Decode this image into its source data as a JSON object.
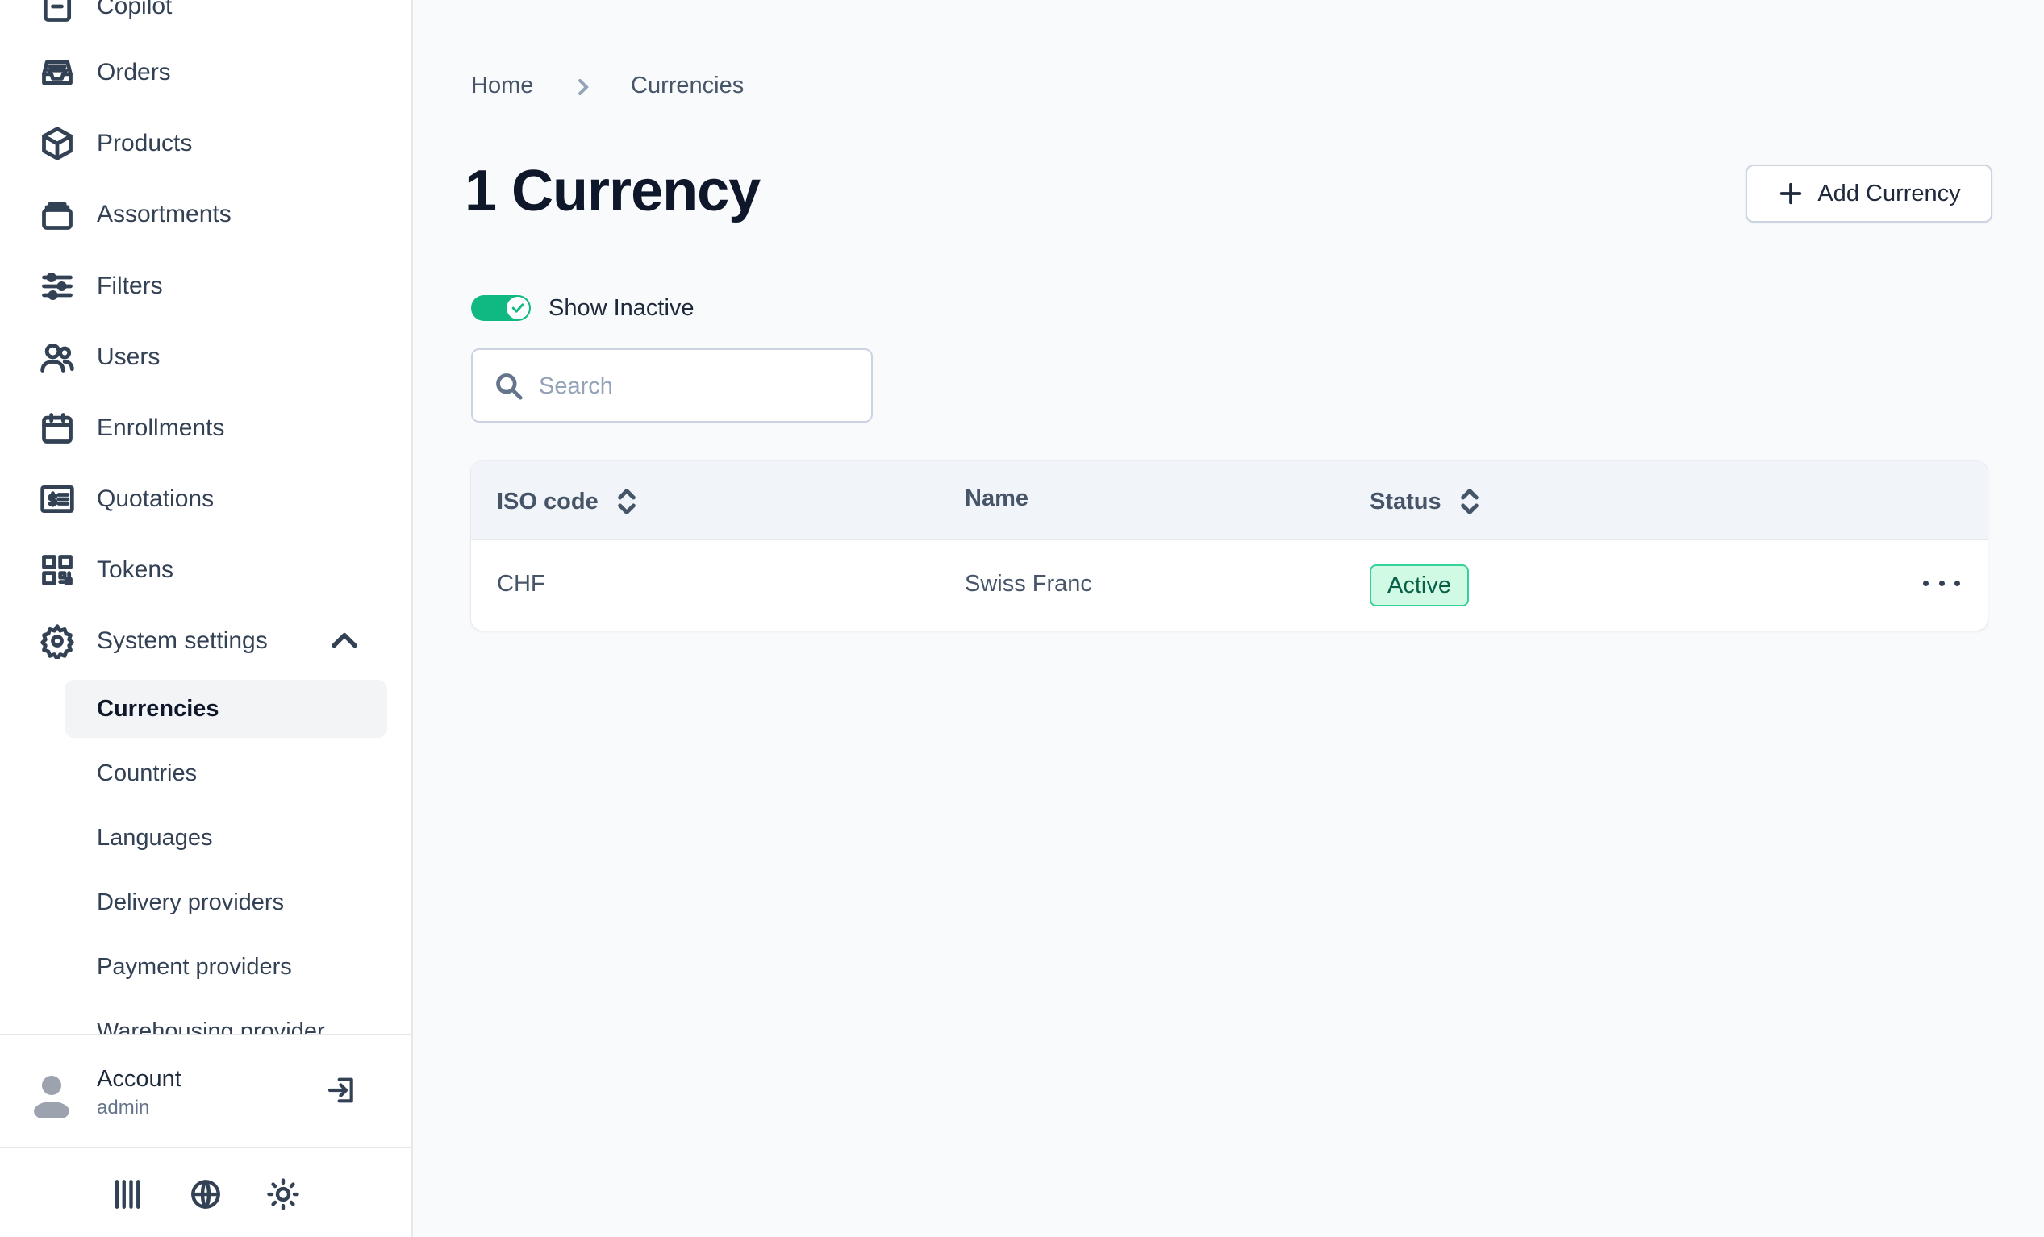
{
  "sidebar": {
    "items": [
      {
        "label": "Copilot",
        "icon": "copilot-icon"
      },
      {
        "label": "Orders",
        "icon": "inbox-icon"
      },
      {
        "label": "Products",
        "icon": "cube-icon"
      },
      {
        "label": "Assortments",
        "icon": "stack-icon"
      },
      {
        "label": "Filters",
        "icon": "sliders-icon"
      },
      {
        "label": "Users",
        "icon": "users-icon"
      },
      {
        "label": "Enrollments",
        "icon": "calendar-icon"
      },
      {
        "label": "Quotations",
        "icon": "receipt-icon"
      },
      {
        "label": "Tokens",
        "icon": "qr-code-icon"
      },
      {
        "label": "System settings",
        "icon": "gear-icon"
      }
    ],
    "sub_items": [
      {
        "label": "Currencies",
        "active": true
      },
      {
        "label": "Countries"
      },
      {
        "label": "Languages"
      },
      {
        "label": "Delivery providers"
      },
      {
        "label": "Payment providers"
      },
      {
        "label": "Warehousing provider"
      }
    ],
    "account": {
      "name": "Account",
      "role": "admin"
    }
  },
  "breadcrumb": {
    "home": "Home",
    "current": "Currencies"
  },
  "page": {
    "title": "1 Currency",
    "add_button": "Add Currency",
    "toggle_label": "Show Inactive",
    "toggle_on": true,
    "search_placeholder": "Search"
  },
  "table": {
    "headers": {
      "iso": "ISO code",
      "name": "Name",
      "status": "Status"
    },
    "rows": [
      {
        "iso": "CHF",
        "name": "Swiss Franc",
        "status": "Active"
      }
    ]
  },
  "colors": {
    "accent": "#10b981",
    "badge_bg": "#d1fae5",
    "badge_text": "#065f46"
  }
}
